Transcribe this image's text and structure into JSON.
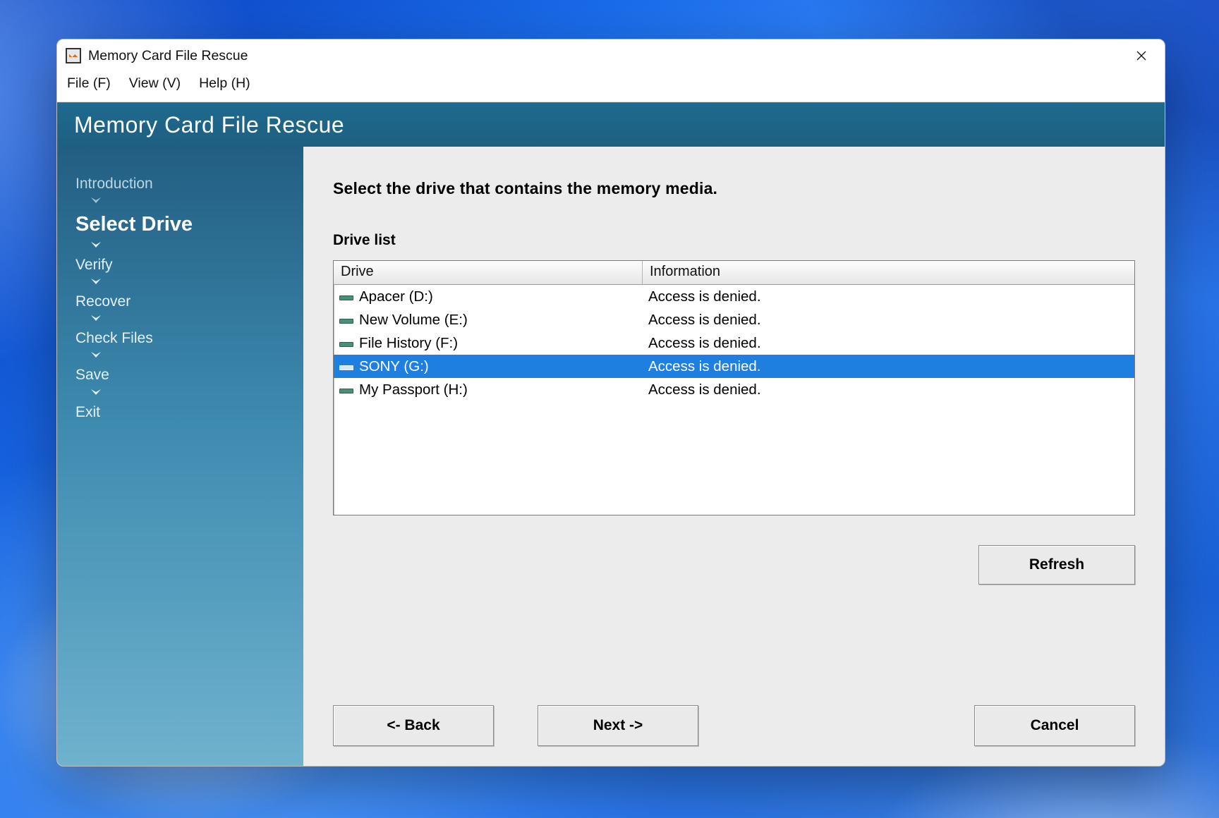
{
  "window": {
    "title": "Memory Card File Rescue"
  },
  "menubar": {
    "file": "File (F)",
    "view": "View (V)",
    "help": "Help (H)"
  },
  "banner": {
    "title": "Memory Card File Rescue"
  },
  "sidebar": {
    "steps": [
      {
        "label": "Introduction",
        "state": "visited"
      },
      {
        "label": "Select Drive",
        "state": "current"
      },
      {
        "label": "Verify",
        "state": "future"
      },
      {
        "label": "Recover",
        "state": "future"
      },
      {
        "label": "Check Files",
        "state": "future"
      },
      {
        "label": "Save",
        "state": "future"
      },
      {
        "label": "Exit",
        "state": "future"
      }
    ]
  },
  "main": {
    "instruction": "Select the drive that contains the memory media.",
    "list_label": "Drive list",
    "columns": {
      "drive": "Drive",
      "info": "Information"
    },
    "rows": [
      {
        "drive": "Apacer (D:)",
        "info": "Access is denied.",
        "selected": false
      },
      {
        "drive": "New Volume (E:)",
        "info": "Access is denied.",
        "selected": false
      },
      {
        "drive": "File History (F:)",
        "info": "Access is denied.",
        "selected": false
      },
      {
        "drive": "SONY (G:)",
        "info": "Access is denied.",
        "selected": true
      },
      {
        "drive": "My Passport (H:)",
        "info": "Access is denied.",
        "selected": false
      }
    ],
    "buttons": {
      "refresh": "Refresh",
      "back": "<- Back",
      "next": "Next ->",
      "cancel": "Cancel"
    }
  }
}
